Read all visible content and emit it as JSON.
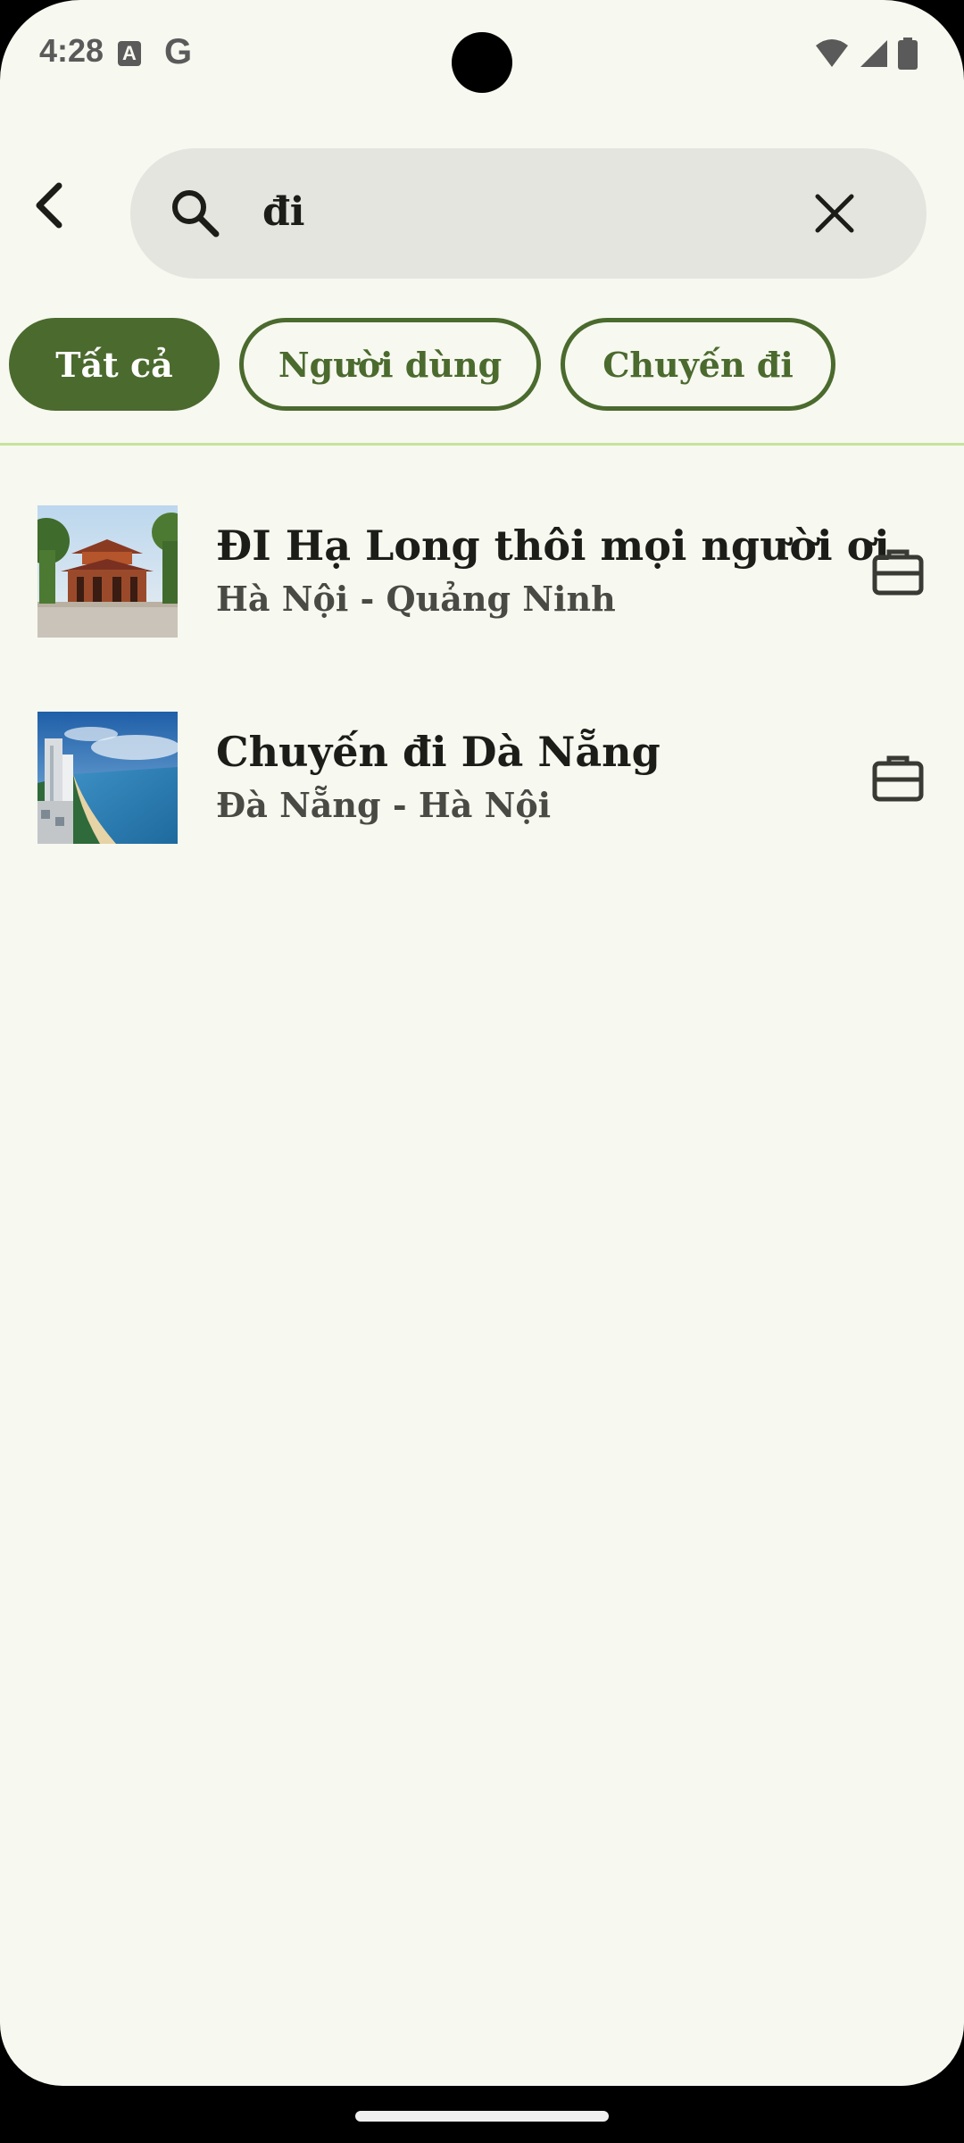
{
  "status_bar": {
    "time": "4:28",
    "a_label": "A",
    "g_label": "G"
  },
  "search": {
    "query": "đi"
  },
  "filters": [
    {
      "label": "Tất cả",
      "active": true
    },
    {
      "label": "Người dùng",
      "active": false
    },
    {
      "label": "Chuyến đi",
      "active": false
    }
  ],
  "results": [
    {
      "title": "ĐI Hạ Long thôi mọi người ơi",
      "subtitle": "Hà Nội - Quảng Ninh",
      "icon": "briefcase-icon"
    },
    {
      "title": "Chuyến đi Dà Nẵng",
      "subtitle": "Đà Nẵng - Hà Nội",
      "icon": "briefcase-icon"
    }
  ],
  "colors": {
    "background": "#f7f8f0",
    "accent": "#4b6a2e",
    "search_bg": "#e4e5de",
    "divider": "#c4e39c"
  }
}
